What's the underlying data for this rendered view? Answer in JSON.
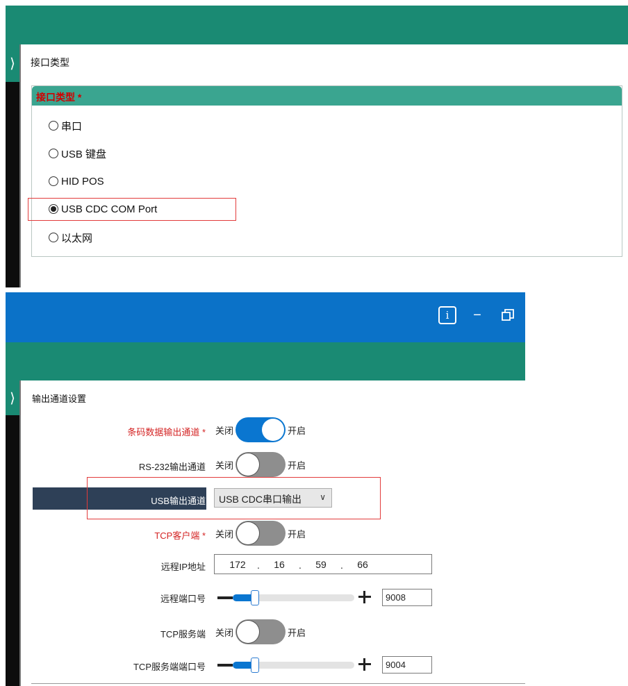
{
  "top": {
    "section_title": "接口类型",
    "group_title": "接口类型",
    "required_mark": "*",
    "options": [
      {
        "label": "串口",
        "selected": false
      },
      {
        "label": "USB 键盘",
        "selected": false
      },
      {
        "label": "HID POS",
        "selected": false
      },
      {
        "label": "USB CDC COM Port",
        "selected": true
      },
      {
        "label": "以太网",
        "selected": false
      }
    ]
  },
  "window": {
    "info_icon": "i",
    "minimize_icon": "−",
    "restore_icon": "restore-icon"
  },
  "bottom": {
    "section_title": "输出通道设置",
    "toggle_off_label": "关闭",
    "toggle_on_label": "开启",
    "barcode_channel": {
      "label": "条码数据输出通道 *",
      "state": "on"
    },
    "rs232_channel": {
      "label": "RS-232输出通道",
      "state": "off"
    },
    "usb_channel": {
      "label": "USB输出通道",
      "value": "USB CDC串口输出"
    },
    "tcp_client": {
      "label": "TCP客户端 *",
      "state": "off"
    },
    "remote_ip": {
      "label": "远程IP地址",
      "octets": [
        "172",
        "16",
        "59",
        "66"
      ],
      "dot": "."
    },
    "remote_port": {
      "label": "远程端口号",
      "value": "9008",
      "slider_fraction": 0.18
    },
    "tcp_server": {
      "label": "TCP服务端",
      "state": "off"
    },
    "tcp_server_port": {
      "label": "TCP服务端端口号",
      "value": "9004",
      "slider_fraction": 0.18
    }
  },
  "colors": {
    "teal": "#1a8a73",
    "blue": "#0b72c8",
    "required": "#d42525",
    "highlight": "#e23b3b"
  }
}
